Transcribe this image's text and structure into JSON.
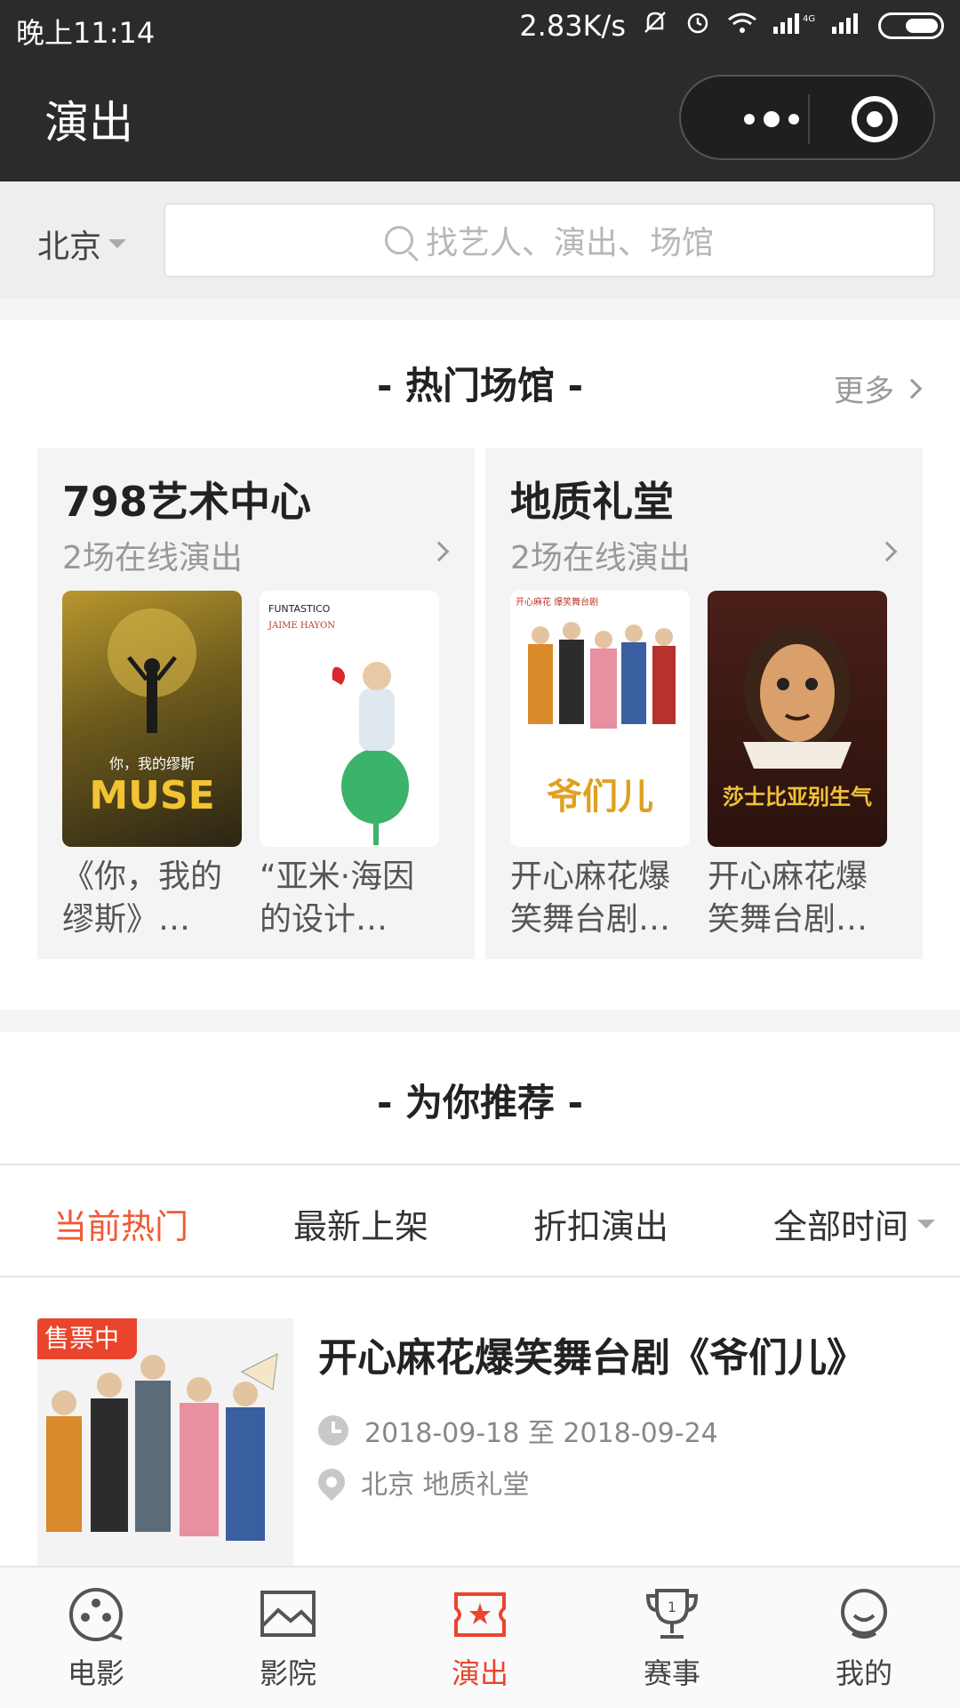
{
  "status_bar": {
    "time": "晚上11:14",
    "speed": "2.83K/s"
  },
  "nav": {
    "title": "演出"
  },
  "search": {
    "city": "北京",
    "placeholder": "找艺人、演出、场馆"
  },
  "venues_section": {
    "title": "- 热门场馆 -",
    "more": "更多",
    "venues": [
      {
        "name": "798艺术中心",
        "sub": "2场在线演出",
        "shows": [
          {
            "caption": "《你，我的缪斯》…",
            "poster_text": "MUSE",
            "poster_sub": "你，我的缪斯"
          },
          {
            "caption": "“亚米·海因的设计…",
            "poster_text": "FUNTASTICO",
            "poster_sub": "JAIME HAYON"
          }
        ]
      },
      {
        "name": "地质礼堂",
        "sub": "2场在线演出",
        "shows": [
          {
            "caption": "开心麻花爆笑舞台剧…",
            "poster_text": "爷们儿",
            "poster_sub": "开心麻花 爆笑舞台剧"
          },
          {
            "caption": "开心麻花爆笑舞台剧…",
            "poster_text": "莎士比亚别生气",
            "poster_sub": ""
          }
        ]
      }
    ]
  },
  "recommend": {
    "title": "- 为你推荐 -",
    "tabs": [
      "当前热门",
      "最新上架",
      "折扣演出",
      "全部时间"
    ],
    "active_tab": 0,
    "item": {
      "badge": "售票中",
      "title": "开心麻花爆笑舞台剧《爷们儿》",
      "date": "2018-09-18 至 2018-09-24",
      "location": "北京 地质礼堂"
    }
  },
  "tabbar": {
    "items": [
      {
        "label": "电影",
        "icon": "film-reel-icon"
      },
      {
        "label": "影院",
        "icon": "cinema-screen-icon"
      },
      {
        "label": "演出",
        "icon": "ticket-icon"
      },
      {
        "label": "赛事",
        "icon": "trophy-icon"
      },
      {
        "label": "我的",
        "icon": "user-icon"
      }
    ],
    "active": 2
  },
  "colors": {
    "accent": "#e8452c",
    "active_tab": "#f05a35",
    "nav_bg": "#2b2b2d"
  }
}
